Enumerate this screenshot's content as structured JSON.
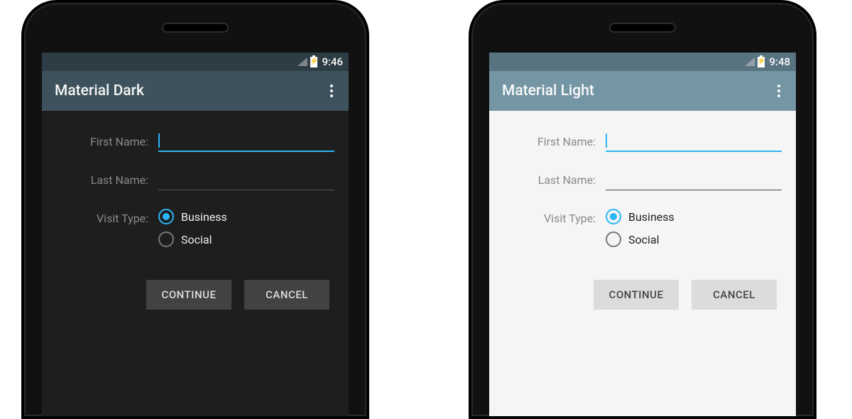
{
  "phones": {
    "dark": {
      "status": {
        "time": "9:46"
      },
      "app_bar": {
        "title": "Material Dark"
      },
      "form": {
        "first_name": {
          "label": "First Name:",
          "value": ""
        },
        "last_name": {
          "label": "Last Name:",
          "value": ""
        },
        "visit_type": {
          "label": "Visit Type:",
          "options": {
            "business": "Business",
            "social": "Social"
          },
          "selected": "business"
        },
        "buttons": {
          "continue": "CONTINUE",
          "cancel": "CANCEL"
        }
      }
    },
    "light": {
      "status": {
        "time": "9:48"
      },
      "app_bar": {
        "title": "Material Light"
      },
      "form": {
        "first_name": {
          "label": "First Name:",
          "value": ""
        },
        "last_name": {
          "label": "Last Name:",
          "value": ""
        },
        "visit_type": {
          "label": "Visit Type:",
          "options": {
            "business": "Business",
            "social": "Social"
          },
          "selected": "business"
        },
        "buttons": {
          "continue": "CONTINUE",
          "cancel": "CANCEL"
        }
      }
    }
  },
  "colors": {
    "accent": "#29b6f6"
  }
}
